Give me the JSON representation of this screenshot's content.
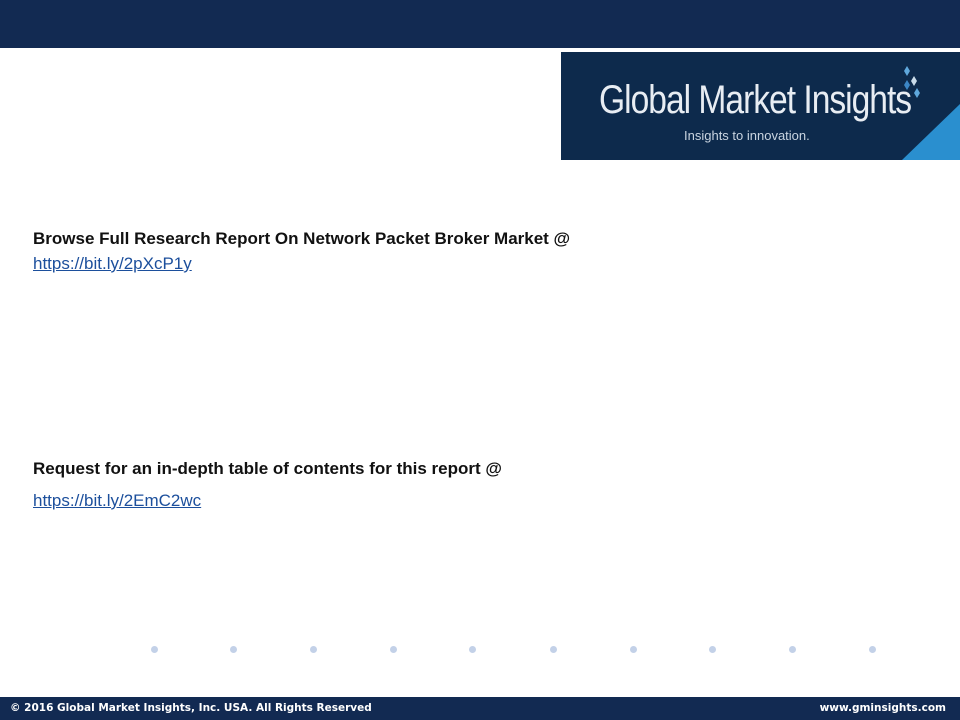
{
  "header": {
    "logo_title": "Global Market Insights",
    "logo_tagline": "Insights to innovation."
  },
  "content": {
    "report_heading": "Browse Full Research Report On Network Packet Broker Market @",
    "report_link": "https://bit.ly/2pXcP1y",
    "toc_heading": "Request for an in-depth table of contents for this report @",
    "toc_link": "https://bit.ly/2EmC2wc"
  },
  "footer": {
    "copyright": "© 2016 Global Market Insights, Inc. USA.  All Rights Reserved",
    "website": "www.gminsights.com"
  },
  "colors": {
    "bar": "#122a52",
    "logo_bg": "#0d2a4c",
    "accent": "#2a8fcf",
    "link": "#1c4f9c",
    "dots": "#c3d1e8"
  }
}
